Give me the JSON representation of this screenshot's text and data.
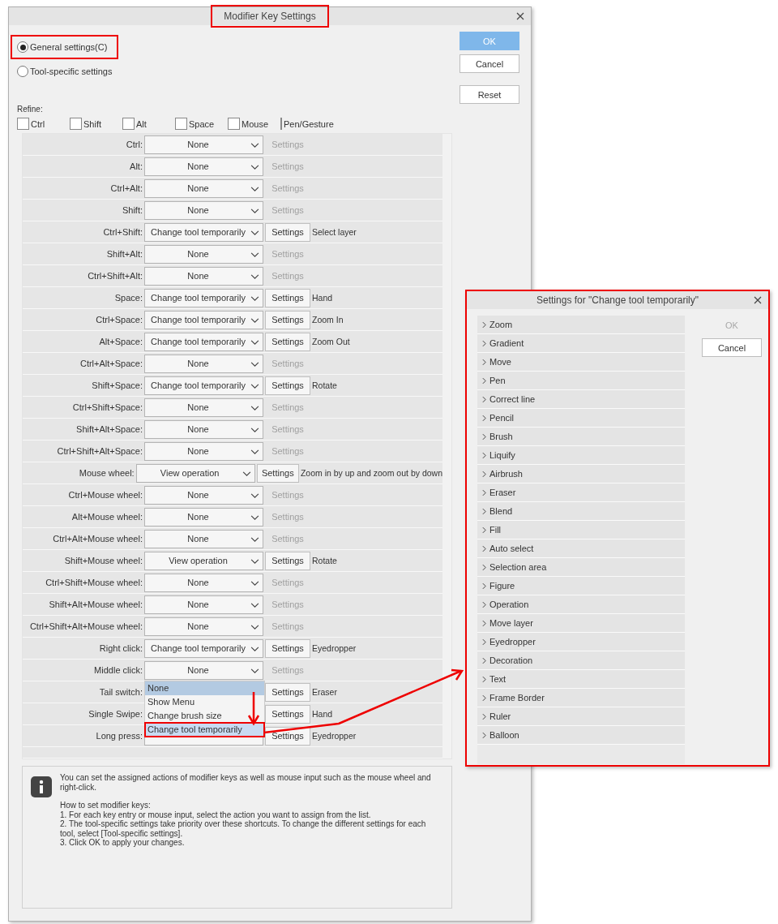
{
  "main_dialog": {
    "title": "Modifier Key Settings",
    "title_callout": true,
    "modes": [
      {
        "label": "General settings(C)",
        "selected": true,
        "callout": true
      },
      {
        "label": "Tool-specific settings",
        "selected": false
      }
    ],
    "buttons": [
      {
        "label": "OK",
        "kind": "primary"
      },
      {
        "label": "Cancel",
        "kind": "normal"
      },
      {
        "label": "Reset",
        "kind": "normal"
      }
    ],
    "refine": {
      "label": "Refine:",
      "filters": [
        {
          "label": "Ctrl",
          "checked": false
        },
        {
          "label": "Shift",
          "checked": false
        },
        {
          "label": "Alt",
          "checked": false
        },
        {
          "label": "Space",
          "checked": false
        },
        {
          "label": "Mouse",
          "checked": false
        },
        {
          "label": "Pen/Gesture",
          "checked": false
        }
      ]
    },
    "rows": [
      {
        "key": "Ctrl:",
        "action": "None",
        "settings": "Settings",
        "enabled": false
      },
      {
        "key": "Alt:",
        "action": "None",
        "settings": "Settings",
        "enabled": false
      },
      {
        "key": "Ctrl+Alt:",
        "action": "None",
        "settings": "Settings",
        "enabled": false
      },
      {
        "key": "Shift:",
        "action": "None",
        "settings": "Settings",
        "enabled": false
      },
      {
        "key": "Ctrl+Shift:",
        "action": "Change tool temporarily",
        "settings": "Settings",
        "enabled": true,
        "target": "Select layer"
      },
      {
        "key": "Shift+Alt:",
        "action": "None",
        "settings": "Settings",
        "enabled": false
      },
      {
        "key": "Ctrl+Shift+Alt:",
        "action": "None",
        "settings": "Settings",
        "enabled": false
      },
      {
        "key": "Space:",
        "action": "Change tool temporarily",
        "settings": "Settings",
        "enabled": true,
        "target": "Hand"
      },
      {
        "key": "Ctrl+Space:",
        "action": "Change tool temporarily",
        "settings": "Settings",
        "enabled": true,
        "target": "Zoom In"
      },
      {
        "key": "Alt+Space:",
        "action": "Change tool temporarily",
        "settings": "Settings",
        "enabled": true,
        "target": "Zoom Out"
      },
      {
        "key": "Ctrl+Alt+Space:",
        "action": "None",
        "settings": "Settings",
        "enabled": false
      },
      {
        "key": "Shift+Space:",
        "action": "Change tool temporarily",
        "settings": "Settings",
        "enabled": true,
        "target": "Rotate"
      },
      {
        "key": "Ctrl+Shift+Space:",
        "action": "None",
        "settings": "Settings",
        "enabled": false
      },
      {
        "key": "Shift+Alt+Space:",
        "action": "None",
        "settings": "Settings",
        "enabled": false
      },
      {
        "key": "Ctrl+Shift+Alt+Space:",
        "action": "None",
        "settings": "Settings",
        "enabled": false
      },
      {
        "key": "Mouse wheel:",
        "action": "View operation",
        "settings": "Settings",
        "enabled": true,
        "target": "Zoom in by up and zoom out by down"
      },
      {
        "key": "Ctrl+Mouse wheel:",
        "action": "None",
        "settings": "Settings",
        "enabled": false
      },
      {
        "key": "Alt+Mouse wheel:",
        "action": "None",
        "settings": "Settings",
        "enabled": false
      },
      {
        "key": "Ctrl+Alt+Mouse wheel:",
        "action": "None",
        "settings": "Settings",
        "enabled": false
      },
      {
        "key": "Shift+Mouse wheel:",
        "action": "View operation",
        "settings": "Settings",
        "enabled": true,
        "target": "Rotate"
      },
      {
        "key": "Ctrl+Shift+Mouse wheel:",
        "action": "None",
        "settings": "Settings",
        "enabled": false
      },
      {
        "key": "Shift+Alt+Mouse wheel:",
        "action": "None",
        "settings": "Settings",
        "enabled": false
      },
      {
        "key": "Ctrl+Shift+Alt+Mouse wheel:",
        "action": "None",
        "settings": "Settings",
        "enabled": false
      },
      {
        "key": "Right click:",
        "action": "Change tool temporarily",
        "settings": "Settings",
        "enabled": true,
        "target": "Eyedropper"
      },
      {
        "key": "Middle click:",
        "action": "None",
        "settings": "Settings",
        "enabled": false,
        "open": true,
        "options": [
          {
            "label": "None",
            "selected": true,
            "hovered": false,
            "callout": false
          },
          {
            "label": "Show Menu",
            "selected": false,
            "hovered": false,
            "callout": false
          },
          {
            "label": "Change brush size",
            "selected": false,
            "hovered": false,
            "callout": false
          },
          {
            "label": "Change tool temporarily",
            "selected": false,
            "hovered": true,
            "callout": true
          }
        ]
      },
      {
        "key": "Tail switch:",
        "settings": "Settings",
        "enabled": true,
        "target": "Eraser"
      },
      {
        "key": "Single Swipe:",
        "settings": "Settings",
        "enabled": true,
        "target": "Hand"
      },
      {
        "key": "Long press:",
        "settings": "Settings",
        "enabled": true,
        "target": "Eyedropper"
      }
    ],
    "info": [
      "You can set the assigned actions of modifier keys as well as mouse input such as the mouse wheel and right-click.",
      "How to set modifier keys:",
      "1. For each key entry or mouse input, select the action you want to assign from the list.",
      "2. The tool-specific settings take priority over these shortcuts. To change the different settings for each tool, select [Tool-specific settings].",
      "3. Click OK to apply your changes."
    ]
  },
  "tool_dialog": {
    "title": "Settings for \"Change tool temporarily\"",
    "callout": true,
    "tools": [
      {
        "label": "Zoom",
        "expanded": false
      },
      {
        "label": "Gradient",
        "expanded": false
      },
      {
        "label": "Move",
        "expanded": false
      },
      {
        "label": "Pen",
        "expanded": false
      },
      {
        "label": "Correct line",
        "expanded": false
      },
      {
        "label": "Pencil",
        "expanded": false
      },
      {
        "label": "Brush",
        "expanded": false
      },
      {
        "label": "Liquify",
        "expanded": false
      },
      {
        "label": "Airbrush",
        "expanded": false
      },
      {
        "label": "Eraser",
        "expanded": false
      },
      {
        "label": "Blend",
        "expanded": false
      },
      {
        "label": "Fill",
        "expanded": false
      },
      {
        "label": "Auto select",
        "expanded": false
      },
      {
        "label": "Selection area",
        "expanded": false
      },
      {
        "label": "Figure",
        "expanded": false
      },
      {
        "label": "Operation",
        "expanded": false
      },
      {
        "label": "Move layer",
        "expanded": false
      },
      {
        "label": "Eyedropper",
        "expanded": false
      },
      {
        "label": "Decoration",
        "expanded": false
      },
      {
        "label": "Text",
        "expanded": false
      },
      {
        "label": "Frame Border",
        "expanded": false
      },
      {
        "label": "Ruler",
        "expanded": false
      },
      {
        "label": "Balloon",
        "expanded": false
      }
    ],
    "buttons": [
      {
        "label": "OK",
        "disabled": true
      },
      {
        "label": "Cancel",
        "disabled": false
      }
    ]
  }
}
